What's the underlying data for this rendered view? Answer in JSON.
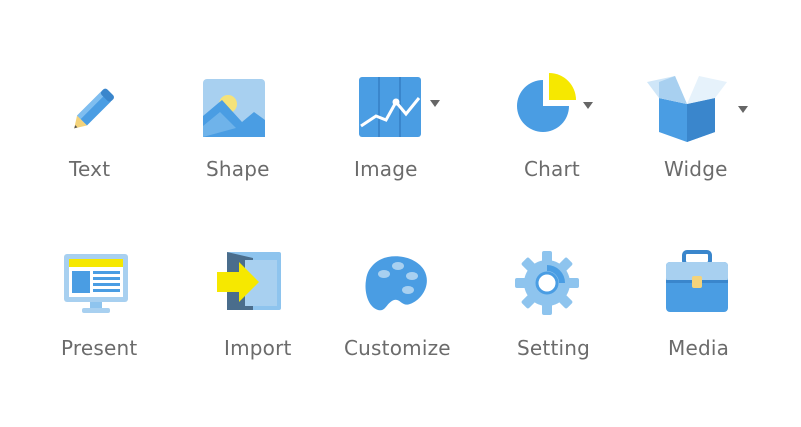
{
  "toolbar": {
    "items": [
      {
        "label": "Text",
        "icon": "pencil-icon"
      },
      {
        "label": "Shape",
        "icon": "shape-icon"
      },
      {
        "label": "Image",
        "icon": "image-icon"
      },
      {
        "label": "Chart",
        "icon": "pie-chart-icon"
      },
      {
        "label": "Widge",
        "icon": "widget-box-icon"
      },
      {
        "label": "Present",
        "icon": "monitor-icon"
      },
      {
        "label": "Import",
        "icon": "import-icon"
      },
      {
        "label": "Customize",
        "icon": "palette-icon"
      },
      {
        "label": "Setting",
        "icon": "gear-icon"
      },
      {
        "label": "Media",
        "icon": "briefcase-icon"
      }
    ]
  },
  "colors": {
    "icon_blue": "#4a9de3",
    "icon_light_blue": "#a8d0f0",
    "accent_yellow": "#f6e800",
    "label_gray": "#6b6b6b",
    "dropdown_gray": "#666666"
  }
}
